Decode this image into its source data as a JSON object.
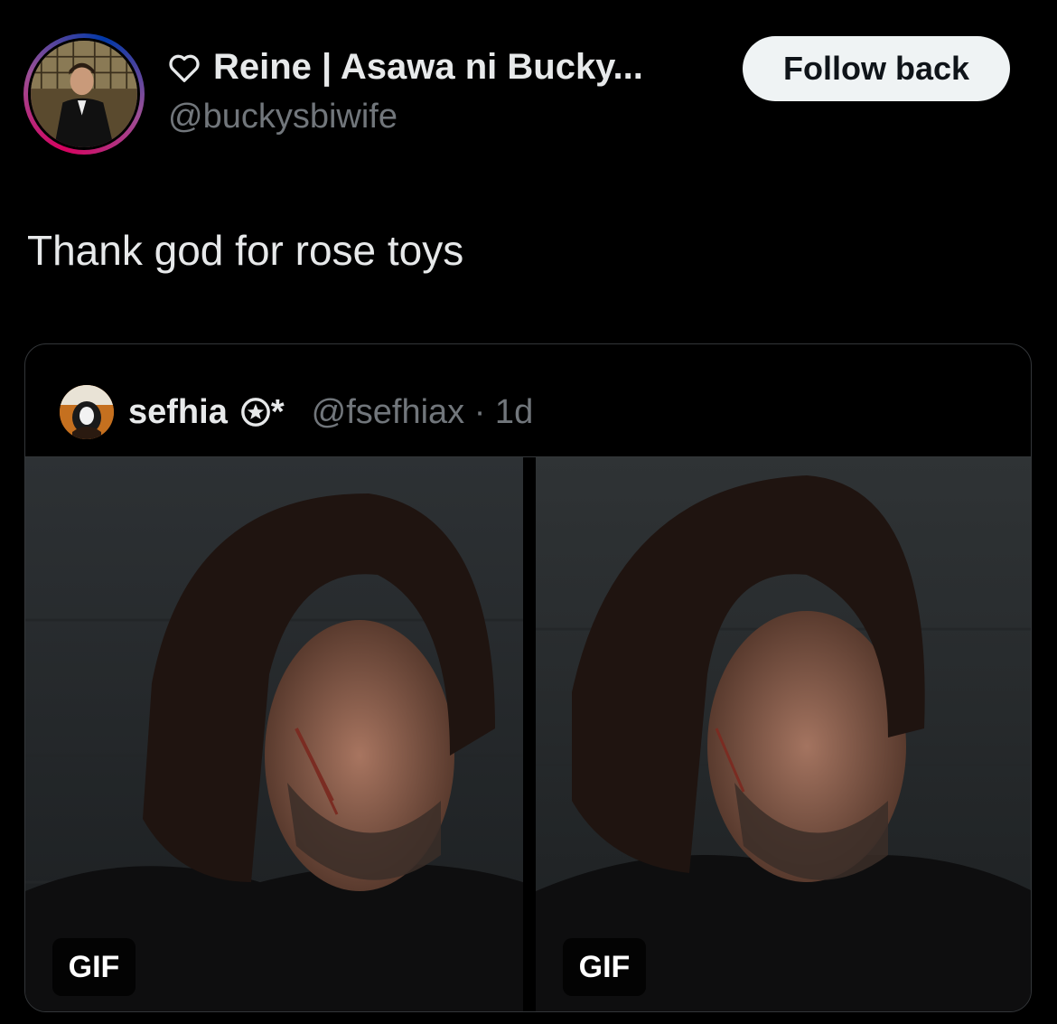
{
  "author": {
    "display_name": "Reine | Asawa ni Bucky...",
    "handle": "@buckysbiwife",
    "icon": "heart-outline-icon",
    "avatar_ring_colors": [
      "#d6025f",
      "#9b4f96",
      "#0038a8"
    ]
  },
  "follow_button": {
    "label": "Follow back"
  },
  "tweet": {
    "text": "Thank god for rose toys"
  },
  "quoted_tweet": {
    "display_name": "sefhia",
    "badge_suffix": "*",
    "badge_icon": "star-circle-icon",
    "handle_time": "@fsefhiax · 1d",
    "media": [
      {
        "badge": "GIF"
      },
      {
        "badge": "GIF"
      }
    ]
  },
  "colors": {
    "background": "#000000",
    "text_primary": "#e7e9ea",
    "text_secondary": "#71767b",
    "border": "#333639",
    "button_bg": "#eff3f4"
  }
}
